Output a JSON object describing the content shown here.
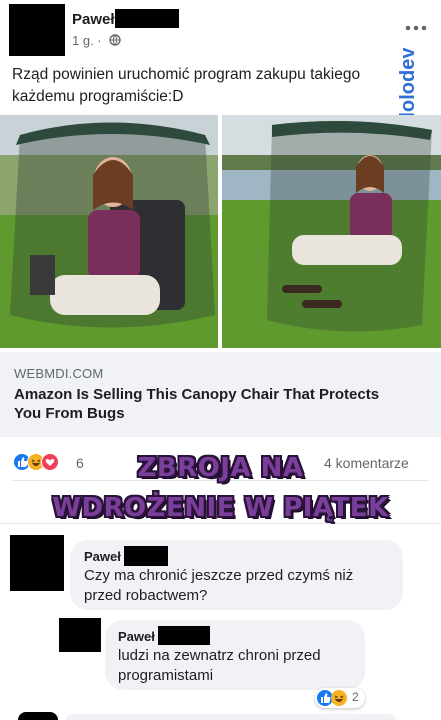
{
  "post": {
    "author": "Paweł",
    "meta": "1 g. ·",
    "text_line1": "Rząd powinien uruchomić program zakupu takiego",
    "text_line2": "każdemu programiście:D"
  },
  "link": {
    "domain": "WEBMDI.COM",
    "title_line1": "Amazon Is Selling This Canopy Chair That Protects",
    "title_line2": "You From Bugs"
  },
  "reactions": {
    "count": "6",
    "comments": "4 komentarze",
    "icons": [
      "like-icon",
      "haha-icon",
      "love-icon"
    ]
  },
  "meme_text": {
    "line1": "ZBROJA NA",
    "line2": "WDROŻENIE W PIĄTEK"
  },
  "comments": [
    {
      "author": "Paweł",
      "text_line1": "Czy ma chronić jeszcze przed czymś niż",
      "text_line2": "przed robactwem?"
    },
    {
      "author": "Paweł",
      "text_line1": "ludzi na zewnatrz chroni przed",
      "text_line2": "programistami",
      "reaction_count": "2"
    }
  ],
  "watermark": "f trolololodev",
  "colors": {
    "facebook_blue": "#1877f2",
    "meme_purple": "#7a3f9b",
    "grass_green": "#5f9a2e"
  }
}
